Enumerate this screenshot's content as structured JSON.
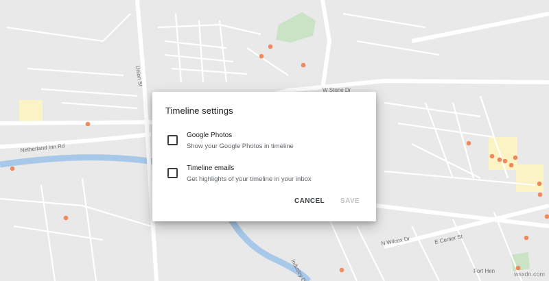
{
  "dialog": {
    "title": "Timeline settings",
    "options": [
      {
        "title": "Google Photos",
        "description": "Show your Google Photos in timeline",
        "checked": false
      },
      {
        "title": "Timeline emails",
        "description": "Get highlights of your timeline in your inbox",
        "checked": false
      }
    ],
    "cancel_label": "CANCEL",
    "save_label": "SAVE",
    "save_enabled": false
  },
  "map": {
    "street_labels": [
      "W Stone Dr",
      "Netherland Inn Rd",
      "E Center St",
      "N Wilcox Dr",
      "Union St",
      "Industry Dr",
      "Fort Hen"
    ],
    "place_marker_color": "#f08a5d",
    "background_color": "#e9e9e9",
    "road_color": "#ffffff",
    "water_color": "#a8c8ea",
    "park_color": "#c9e3c4",
    "highlight_color": "#fbf3c3"
  },
  "watermark": "wsxdn.com"
}
